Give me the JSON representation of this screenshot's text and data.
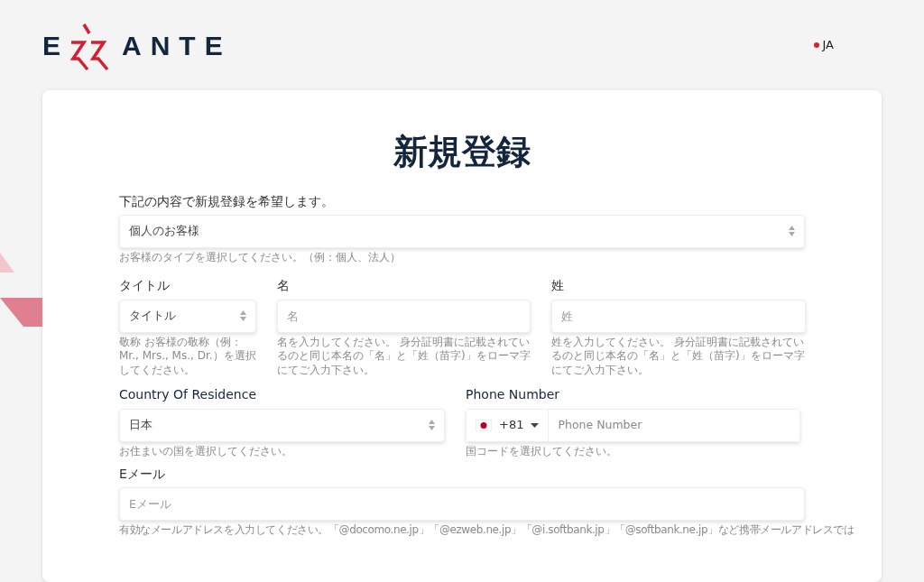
{
  "header": {
    "logo": {
      "left": "E",
      "right": "ANTE"
    },
    "language": "JA"
  },
  "title": "新規登録",
  "customer_type": {
    "label": "下記の内容で新規登録を希望します。",
    "value": "個人のお客様",
    "hint": "お客様のタイプを選択してください。（例：個人、法人）"
  },
  "name_fields": [
    {
      "kind": "select",
      "label": "タイトル",
      "value": "タイトル",
      "hint": "敬称 お客様の敬称（例：Mr., Mrs., Ms., Dr.）を選択してください。"
    },
    {
      "kind": "input",
      "label": "名",
      "placeholder": "名",
      "hint": "名を入力してください。 身分証明書に記載されているのと同じ本名の「名」と「姓（苗字)」をローマ字にてご入力下さい。"
    },
    {
      "kind": "input",
      "label": "姓",
      "placeholder": "姓",
      "hint": "姓を入力してください。 身分証明書に記載されているのと同じ本名の「名」と「姓（苗字)」をローマ字にてご入力下さい。"
    }
  ],
  "country": {
    "label": "Country Of Residence",
    "value": "日本",
    "hint": "お住まいの国を選択してください。"
  },
  "phone": {
    "label": "Phone Number",
    "code": "+81",
    "placeholder": "Phone Number",
    "hint": "国コードを選択してください。"
  },
  "email": {
    "label": "Eメール",
    "placeholder": "Eメール",
    "hint": "有効なメールアドレスを入力してください。「@docomo.ne.jp」「@ezweb.ne.jp」「@i.softbank.jp」「@softbank.ne.jp」など携帯メールアドレスでは"
  }
}
